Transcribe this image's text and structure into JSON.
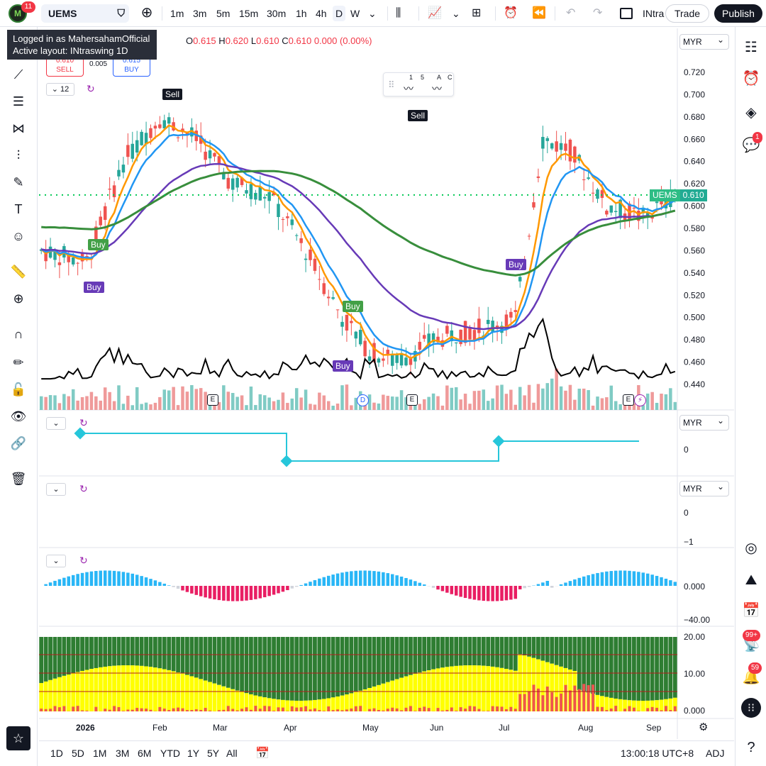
{
  "header": {
    "symbol": "UEMS",
    "logo_badge": "11",
    "timeframes": [
      "1m",
      "3m",
      "5m",
      "15m",
      "30m",
      "1h",
      "4h",
      "D",
      "W"
    ],
    "active_timeframe": "D",
    "layout_name": "INtra",
    "trade_label": "Trade",
    "publish_label": "Publish"
  },
  "tooltip": {
    "line1": "Logged in as MahersahamOfficial",
    "line2": "Active layout: INtraswing 1D"
  },
  "legend": {
    "o_label": "O",
    "o_value": "0.615",
    "h_label": "H",
    "h_value": "0.620",
    "l_label": "L",
    "l_value": "0.610",
    "c_label": "C",
    "c_value": "0.610",
    "change": "0.000 (0.00%)"
  },
  "order_panel": {
    "sell_price": "0.610",
    "sell_label": "SELL",
    "spread": "0.005",
    "buy_price": "0.615",
    "buy_label": "BUY"
  },
  "indicator_count": "12",
  "currency": "MYR",
  "price_tag": {
    "symbol": "UEMS",
    "price": "0.610"
  },
  "price_axis": [
    "0.720",
    "0.700",
    "0.680",
    "0.660",
    "0.640",
    "0.620",
    "0.600",
    "0.580",
    "0.560",
    "0.540",
    "0.520",
    "0.500",
    "0.480",
    "0.460",
    "0.440"
  ],
  "pane2_axis": [
    "0"
  ],
  "pane3_axis": [
    "0",
    "−1"
  ],
  "pane4_axis": [
    "0.000",
    "−40.00"
  ],
  "pane5_axis": [
    "20.00",
    "10.00",
    "0.000"
  ],
  "time_axis": [
    "2026",
    "Feb",
    "Mar",
    "Apr",
    "May",
    "Jun",
    "Jul",
    "Aug",
    "Sep"
  ],
  "signals": {
    "sell": "Sell",
    "buy": "Buy",
    "earnings": "E",
    "dividend": "D"
  },
  "toolset": {
    "top1": "1",
    "top2": "5",
    "top3": "A",
    "top4": "C"
  },
  "ranges": [
    "1D",
    "5D",
    "1M",
    "3M",
    "6M",
    "YTD",
    "1Y",
    "5Y",
    "All"
  ],
  "clock": "13:00:18 UTC+8",
  "adj": "ADJ",
  "right_badges": {
    "chat": "1",
    "streams": "99+",
    "alerts": "59"
  },
  "colors": {
    "up": "#26a69a",
    "down": "#ef5350",
    "ema_blue": "#2196f3",
    "ema_orange": "#ff9800",
    "ema_purple": "#673ab7",
    "ema_green": "#388e3c",
    "step": "#26c6da"
  }
}
